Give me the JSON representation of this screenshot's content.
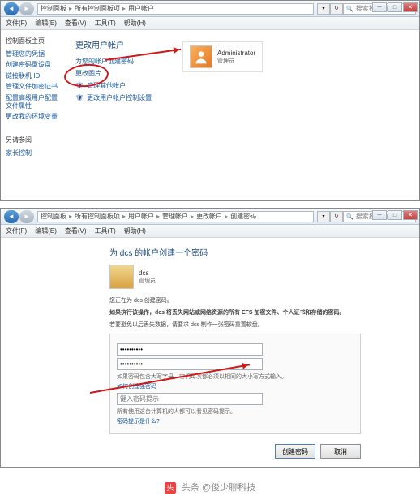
{
  "win1": {
    "breadcrumb": [
      "控制面板",
      "所有控制面板项",
      "用户帐户"
    ],
    "search_placeholder": "搜索控制面板",
    "menu": [
      "文件(F)",
      "编辑(E)",
      "查看(V)",
      "工具(T)",
      "帮助(H)"
    ],
    "sidebar": {
      "heading": "控制面板主页",
      "items": [
        "管理您的凭据",
        "创建密码重设盘",
        "链接联机 ID",
        "管理文件加密证书",
        "配置高级用户配置文件属性",
        "更改我的环境变量"
      ],
      "see_also": "另请参阅",
      "see_items": [
        "家长控制"
      ]
    },
    "main": {
      "title": "更改用户帐户",
      "links": [
        "为您的帐户创建密码",
        "更改图片"
      ],
      "circled_link": "管理其他帐户",
      "uac_link": "更改用户帐户控制设置"
    },
    "user": {
      "name": "Administrator",
      "role": "管理员"
    }
  },
  "win2": {
    "breadcrumb": [
      "控制面板",
      "所有控制面板项",
      "用户帐户",
      "管理帐户",
      "更改帐户",
      "创建密码"
    ],
    "search_placeholder": "搜索控制面板",
    "menu": [
      "文件(F)",
      "编辑(E)",
      "查看(V)",
      "工具(T)",
      "帮助(H)"
    ],
    "title": "为 dcs 的帐户创建一个密码",
    "user": {
      "name": "dcs",
      "role": "管理员"
    },
    "warn_line": "您正在为 dcs 创建密码。",
    "warn_bold": "如果执行该操作，dcs 将丢失网站或网络资源的所有 EFS 加密文件、个人证书和存储的密码。",
    "warn_line2": "若要避免以后丢失数据，请要求 dcs 制作一张密码重置软盘。",
    "pw1": "••••••••••",
    "pw2": "••••••••••",
    "hint1": "如果密码包含大写字母，它们每次都必须以相同的大小写方式输入。",
    "hint2": "如何创建强密码",
    "hint_ph": "键入密码提示",
    "hint3": "所有使用这台计算机的人都可以看见密码提示。",
    "hint4": "密码提示是什么?",
    "btn_ok": "创建密码",
    "btn_cancel": "取消"
  },
  "watermark": {
    "prefix": "头条",
    "text": "@俊少聊科技"
  }
}
